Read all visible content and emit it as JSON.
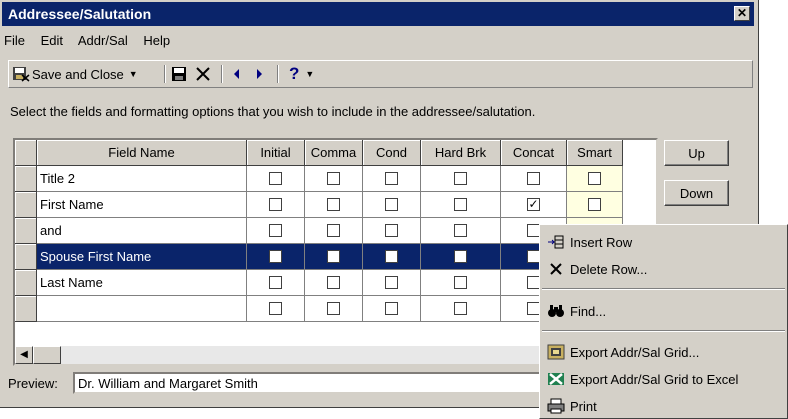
{
  "window": {
    "title": "Addressee/Salutation",
    "close_glyph": "✕"
  },
  "menubar": {
    "items": [
      {
        "label": "File"
      },
      {
        "label": "Edit"
      },
      {
        "label": "Addr/Sal"
      },
      {
        "label": "Help"
      }
    ]
  },
  "toolbar": {
    "save_close": "Save and Close"
  },
  "instructions": "Select the fields and formatting options that you wish to include in the addressee/salutation.",
  "grid": {
    "columns": [
      "Field Name",
      "Initial",
      "Comma",
      "Cond",
      "Hard Brk",
      "Concat",
      "Smart"
    ],
    "rows": [
      {
        "name": "Title 2",
        "checks": [
          false,
          false,
          false,
          false,
          false,
          false
        ]
      },
      {
        "name": "First Name",
        "checks": [
          false,
          false,
          false,
          false,
          true,
          false
        ]
      },
      {
        "name": "and",
        "checks": [
          false,
          false,
          false,
          false,
          false,
          false
        ]
      },
      {
        "name": "Spouse First Name",
        "checks": [
          false,
          false,
          false,
          false,
          false,
          false
        ],
        "selected": true
      },
      {
        "name": "Last Name",
        "checks": [
          false,
          false,
          false,
          false,
          false,
          false
        ]
      },
      {
        "name": "",
        "checks": [
          false,
          false,
          false,
          false,
          false,
          false
        ]
      }
    ]
  },
  "buttons": {
    "up": "Up",
    "down": "Down"
  },
  "preview": {
    "label": "Preview:",
    "value": "Dr. William and Margaret Smith"
  },
  "context_menu": {
    "insert_row": "Insert Row",
    "delete_row": "Delete Row...",
    "find": "Find...",
    "export_grid": "Export Addr/Sal Grid...",
    "export_excel": "Export Addr/Sal Grid to Excel",
    "print": "Print"
  }
}
